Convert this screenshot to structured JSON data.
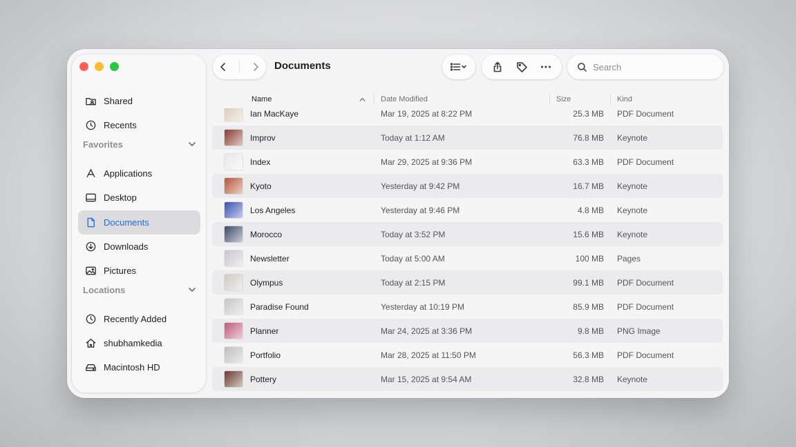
{
  "window": {
    "title": "Documents",
    "accent_color": "#1a6fe0"
  },
  "sidebar": {
    "items_top": [
      {
        "label": "Shared",
        "icon": "shared-folder-icon"
      },
      {
        "label": "Recents",
        "icon": "clock-icon"
      }
    ],
    "favorites_label": "Favorites",
    "favorites": [
      {
        "label": "Applications",
        "icon": "applications-icon"
      },
      {
        "label": "Desktop",
        "icon": "desktop-icon"
      },
      {
        "label": "Documents",
        "icon": "document-icon",
        "selected": true
      },
      {
        "label": "Downloads",
        "icon": "download-icon"
      },
      {
        "label": "Pictures",
        "icon": "photo-icon"
      }
    ],
    "locations_label": "Locations",
    "locations": [
      {
        "label": "Recently Added",
        "icon": "clock-icon"
      },
      {
        "label": "shubhamkedia",
        "icon": "home-icon"
      },
      {
        "label": "Macintosh HD",
        "icon": "drive-icon"
      }
    ]
  },
  "toolbar": {
    "search_placeholder": "Search",
    "view_icon": "list-view-icon",
    "share_icon": "share-icon",
    "tag_icon": "tag-icon",
    "more_icon": "more-icon"
  },
  "columns": {
    "name": "Name",
    "date": "Date Modified",
    "size": "Size",
    "kind": "Kind"
  },
  "files": [
    {
      "name": "Ian MacKaye",
      "date": "Mar 19, 2025 at 8:22 PM",
      "size": "25.3 MB",
      "kind": "PDF Document",
      "thumb": "#d9c9b8"
    },
    {
      "name": "Improv",
      "date": "Today at 1:12 AM",
      "size": "76.8 MB",
      "kind": "Keynote",
      "thumb": "#8a3a32"
    },
    {
      "name": "Index",
      "date": "Mar 29, 2025 at 9:36 PM",
      "size": "63.3 MB",
      "kind": "PDF Document",
      "thumb": "#e8e8ea"
    },
    {
      "name": "Kyoto",
      "date": "Yesterday at 9:42 PM",
      "size": "16.7 MB",
      "kind": "Keynote",
      "thumb": "#b5553a"
    },
    {
      "name": "Los Angeles",
      "date": "Yesterday at 9:46 PM",
      "size": "4.8 MB",
      "kind": "Keynote",
      "thumb": "#3a4fb0"
    },
    {
      "name": "Morocco",
      "date": "Today at 3:52 PM",
      "size": "15.6 MB",
      "kind": "Keynote",
      "thumb": "#3b4a6a"
    },
    {
      "name": "Newsletter",
      "date": "Today at 5:00 AM",
      "size": "100 MB",
      "kind": "Pages",
      "thumb": "#c9c4cc"
    },
    {
      "name": "Olympus",
      "date": "Today at 2:15 PM",
      "size": "99.1 MB",
      "kind": "PDF Document",
      "thumb": "#cfc8c2"
    },
    {
      "name": "Paradise Found",
      "date": "Yesterday at 10:19 PM",
      "size": "85.9 MB",
      "kind": "PDF Document",
      "thumb": "#c6c6c8"
    },
    {
      "name": "Planner",
      "date": "Mar 24, 2025 at 3:36 PM",
      "size": "9.8 MB",
      "kind": "PNG Image",
      "thumb": "#c05a7a"
    },
    {
      "name": "Portfolio",
      "date": "Mar 28, 2025 at 11:50 PM",
      "size": "56.3 MB",
      "kind": "PDF Document",
      "thumb": "#bdbdbf"
    },
    {
      "name": "Pottery",
      "date": "Mar 15, 2025 at 9:54 AM",
      "size": "32.8 MB",
      "kind": "Keynote",
      "thumb": "#6a3a2e"
    }
  ]
}
